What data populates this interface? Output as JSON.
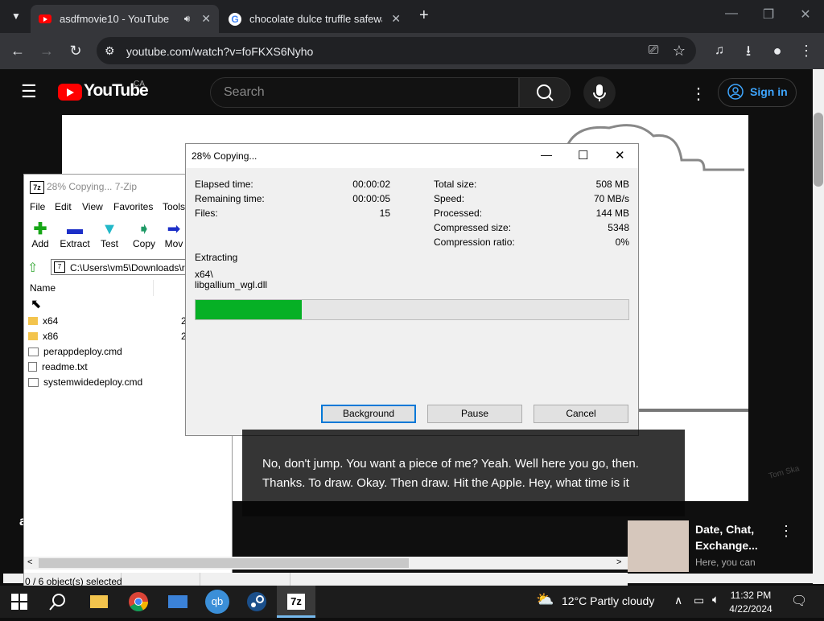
{
  "browser": {
    "tabs": [
      {
        "title": "asdfmovie10 - YouTube",
        "active": true
      },
      {
        "title": "chocolate dulce truffle safeway",
        "active": false
      }
    ],
    "new_tab": "+",
    "url": "youtube.com/watch?v=foFKXS6Nyho"
  },
  "youtube": {
    "logo_text": "YouTube",
    "country": "CA",
    "search_placeholder": "Search",
    "sign_in": "Sign in",
    "caption": "No, don't jump. You want a piece of me? Yeah. Well here you go, then. Thanks. To draw. Okay. Then draw. Hit the Apple. Hey, what time is it",
    "recommendation": {
      "title": "Date, Chat, Exchange...",
      "subtitle": "Here, you can"
    },
    "left_partial_letter": "a"
  },
  "zip_window": {
    "title": "28% Copying... 7-Zip",
    "menu": [
      "File",
      "Edit",
      "View",
      "Favorites",
      "Tools"
    ],
    "toolbar": [
      "Add",
      "Extract",
      "Test",
      "Copy",
      "Mov"
    ],
    "address": "C:\\Users\\vm5\\Downloads\\r",
    "column_name": "Name",
    "files": [
      {
        "name": "x64",
        "type": "folder",
        "trail": "2"
      },
      {
        "name": "x86",
        "type": "folder",
        "trail": "2"
      },
      {
        "name": "perappdeploy.cmd",
        "type": "cmd",
        "trail": ""
      },
      {
        "name": "readme.txt",
        "type": "txt",
        "trail": ""
      },
      {
        "name": "systemwidedeploy.cmd",
        "type": "cmd",
        "trail": ""
      }
    ],
    "status": "0 / 6 object(s) selected"
  },
  "progress_dialog": {
    "title": "28% Copying...",
    "left_stats": [
      {
        "label": "Elapsed time:",
        "value": "00:00:02"
      },
      {
        "label": "Remaining time:",
        "value": "00:00:05"
      },
      {
        "label": "Files:",
        "value": "15"
      }
    ],
    "right_stats": [
      {
        "label": "Total size:",
        "value": "508 MB"
      },
      {
        "label": "Speed:",
        "value": "70 MB/s"
      },
      {
        "label": "Processed:",
        "value": "144 MB"
      },
      {
        "label": "Compressed size:",
        "value": "5348"
      },
      {
        "label": "Compression ratio:",
        "value": "0%"
      }
    ],
    "action": "Extracting",
    "path_line1": "x64\\",
    "path_line2": "libgallium_wgl.dll",
    "progress": 0.245,
    "buttons": [
      "Background",
      "Pause",
      "Cancel"
    ]
  },
  "taskbar": {
    "apps": [
      "start",
      "search",
      "file-explorer",
      "chrome",
      "mail",
      "qbittorrent",
      "steam",
      "7zip"
    ],
    "qb_label": "qb",
    "zip_label": "7z",
    "weather": "12°C  Partly cloudy",
    "time": "11:32 PM",
    "date": "4/22/2024"
  },
  "colors": {
    "progress": "#06b025",
    "youtube_red": "#ff0000",
    "signin_blue": "#3ea6ff"
  }
}
